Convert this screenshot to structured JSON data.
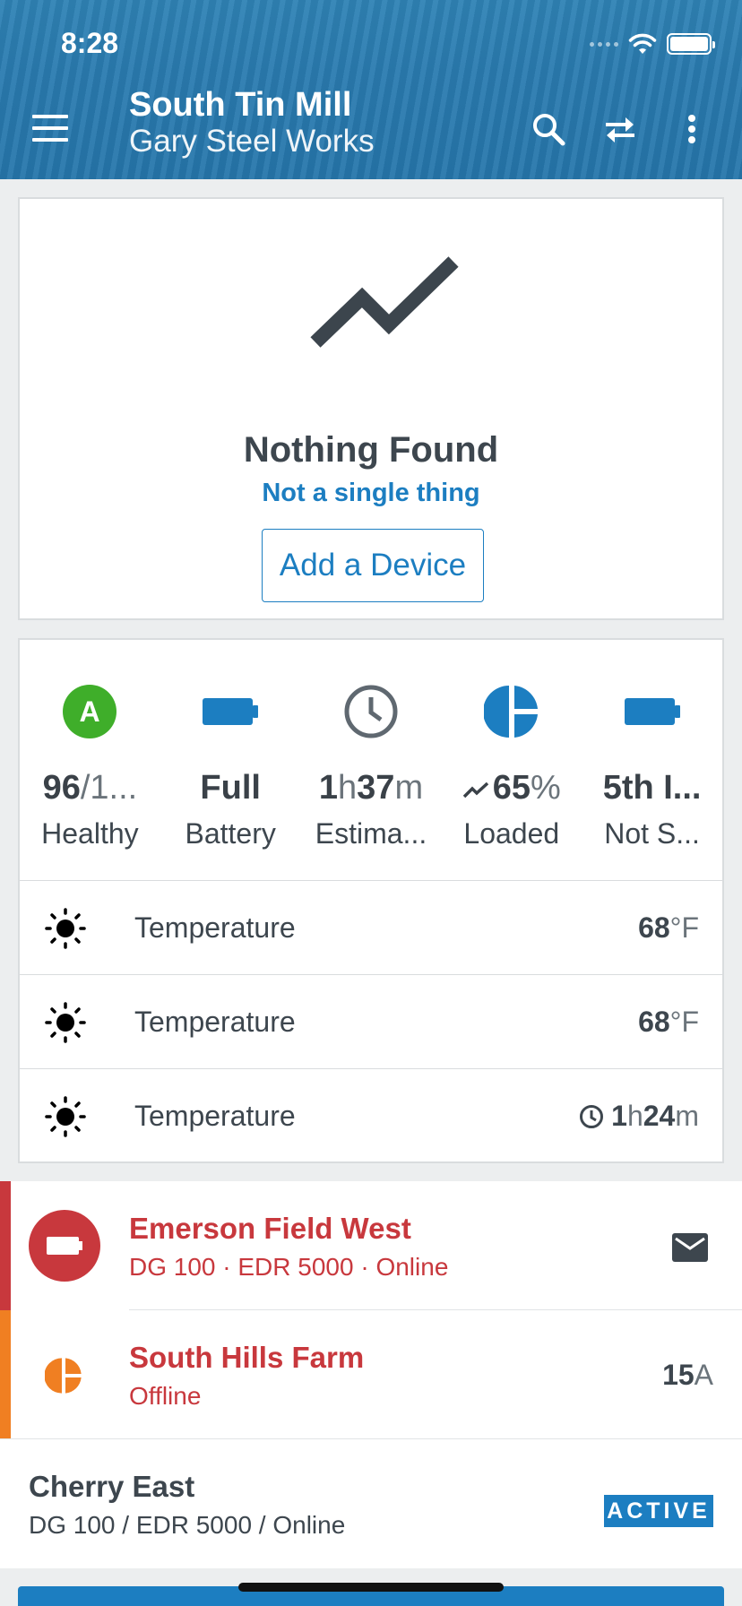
{
  "status_bar": {
    "time": "8:28"
  },
  "header": {
    "title": "South Tin Mill",
    "subtitle": "Gary Steel Works",
    "icons": [
      "menu-icon",
      "search-icon",
      "swap-icon",
      "more-vert-icon"
    ]
  },
  "empty_state": {
    "icon": "trending-up-icon",
    "title": "Nothing Found",
    "subtitle": "Not a single thing",
    "button_label": "Add a Device"
  },
  "stats": [
    {
      "icon": "grade-a-icon",
      "value_main": "96",
      "value_rest": "/1...",
      "label": "Healthy",
      "color": "#3fae2a"
    },
    {
      "icon": "battery-full-icon",
      "value_main": "Full",
      "value_rest": "",
      "label": "Battery",
      "color": "#1c7ec1"
    },
    {
      "icon": "clock-icon",
      "h_num": "1",
      "h_unit": "h",
      "m_num": "37",
      "m_unit": "m",
      "label": "Estima...",
      "color": "#5f6870"
    },
    {
      "icon": "pie-chart-icon",
      "value_main": "65",
      "value_rest": "%",
      "label": "Loaded",
      "color": "#1c7ec1",
      "trend_icon": "trending-up-icon"
    },
    {
      "icon": "battery-full-icon",
      "value_main": "5th I...",
      "value_rest": "",
      "label": "Not S...",
      "color": "#1c7ec1"
    }
  ],
  "readings": [
    {
      "icon": "sun-icon",
      "label": "Temperature",
      "value": "68",
      "unit": "°F"
    },
    {
      "icon": "sun-icon",
      "label": "Temperature",
      "value": "68",
      "unit": "°F"
    },
    {
      "icon": "sun-icon",
      "label": "Temperature",
      "h_num": "1",
      "h_unit": "h",
      "m_num": "24",
      "m_unit": "m",
      "value_icon": "clock-icon"
    }
  ],
  "devices": [
    {
      "name": "Emerson Field West",
      "details": "DG 100 · EDR 5000 · Online",
      "accent": "#c8383d",
      "icon": "battery-icon",
      "action_icon": "mail-icon"
    },
    {
      "name": "South Hills Farm",
      "details": "Offline",
      "accent": "#f07f22",
      "icon": "pie-chart-icon",
      "value": "15",
      "unit": "A"
    },
    {
      "name": "Cherry East",
      "details": "DG 100 / EDR 5000 / Online",
      "badge": "ACTIVE"
    }
  ],
  "colors": {
    "primary": "#1c7ec1",
    "danger": "#c8383d",
    "warning": "#f07f22",
    "success": "#3fae2a"
  }
}
